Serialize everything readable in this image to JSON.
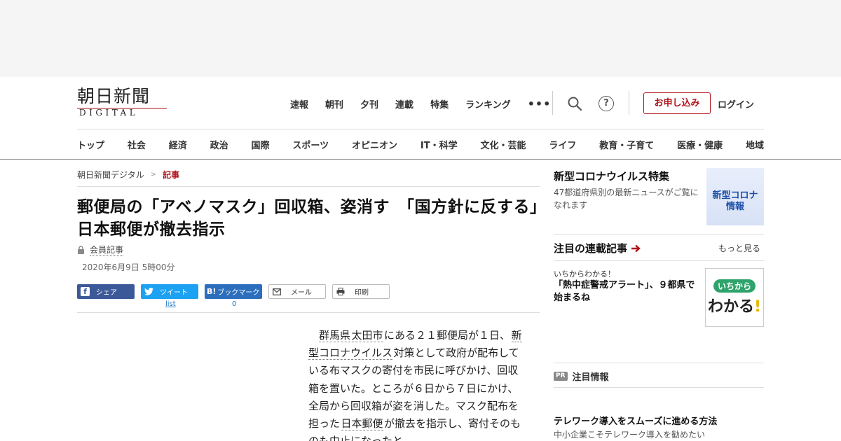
{
  "logo": {
    "jp": "朝日新聞",
    "en": "DIGITAL"
  },
  "topnav": {
    "items": [
      "速報",
      "朝刊",
      "夕刊",
      "連載",
      "特集",
      "ランキング"
    ],
    "more": "•••",
    "subscribe": "お申し込み",
    "login": "ログイン",
    "help": "?"
  },
  "catnav": [
    "トップ",
    "社会",
    "経済",
    "政治",
    "国際",
    "スポーツ",
    "オピニオン",
    "IT・科学",
    "文化・芸能",
    "ライフ",
    "教育・子育て",
    "医療・健康",
    "地域"
  ],
  "breadcrumb": {
    "home": "朝日新聞デジタル",
    "sep": ">",
    "current": "記事"
  },
  "article": {
    "title": "郵便局の「アベノマスク」回収箱、姿消す　「国方針に反する」日本郵便が撤去指示",
    "member": "会員記事",
    "date": "2020年6月9日 5時00分",
    "body": {
      "p1": "群馬県",
      "p2": "太田市",
      "p3": "にある２１郵便局が１日、",
      "p4": "新型コロナウイルス",
      "p5": "対策として政府が配布している布マスクの寄付を市民に呼びかけ、回収箱を置いた。ところが６日から７日にかけ、全局から回収箱が姿を消した。マスク配布を担った",
      "p6": "日本郵便",
      "p7": "が撤去を指示し、寄付そのものも中止になったと"
    }
  },
  "share": {
    "facebook": "シェア",
    "twitter": "ツイート",
    "twitter_count": "list",
    "hatena": "ブックマーク",
    "hatena_icon": "B!",
    "hatena_count": "0",
    "mail": "メール",
    "print": "印刷"
  },
  "sidebar": {
    "corona": {
      "title": "新型コロナウイルス特集",
      "desc": "47都道府県別の最新ニュースがご覧になれます",
      "thumb_line1": "新型コロナ",
      "thumb_line2": "情報"
    },
    "series": {
      "heading": "注目の連載記事",
      "more": "もっと見る",
      "tag": "いちからわかる！",
      "title": "「熱中症警戒アラート」、９都県で始まるね",
      "thumb_pill": "いちから",
      "thumb_big": "わかる",
      "thumb_ex": "!"
    },
    "pr": {
      "badge": "PR",
      "label": "注目情報"
    },
    "telework": {
      "title": "テレワーク導入をスムーズに進める方法",
      "desc": "中小企業こそテレワーク導入を勧めたい"
    }
  }
}
